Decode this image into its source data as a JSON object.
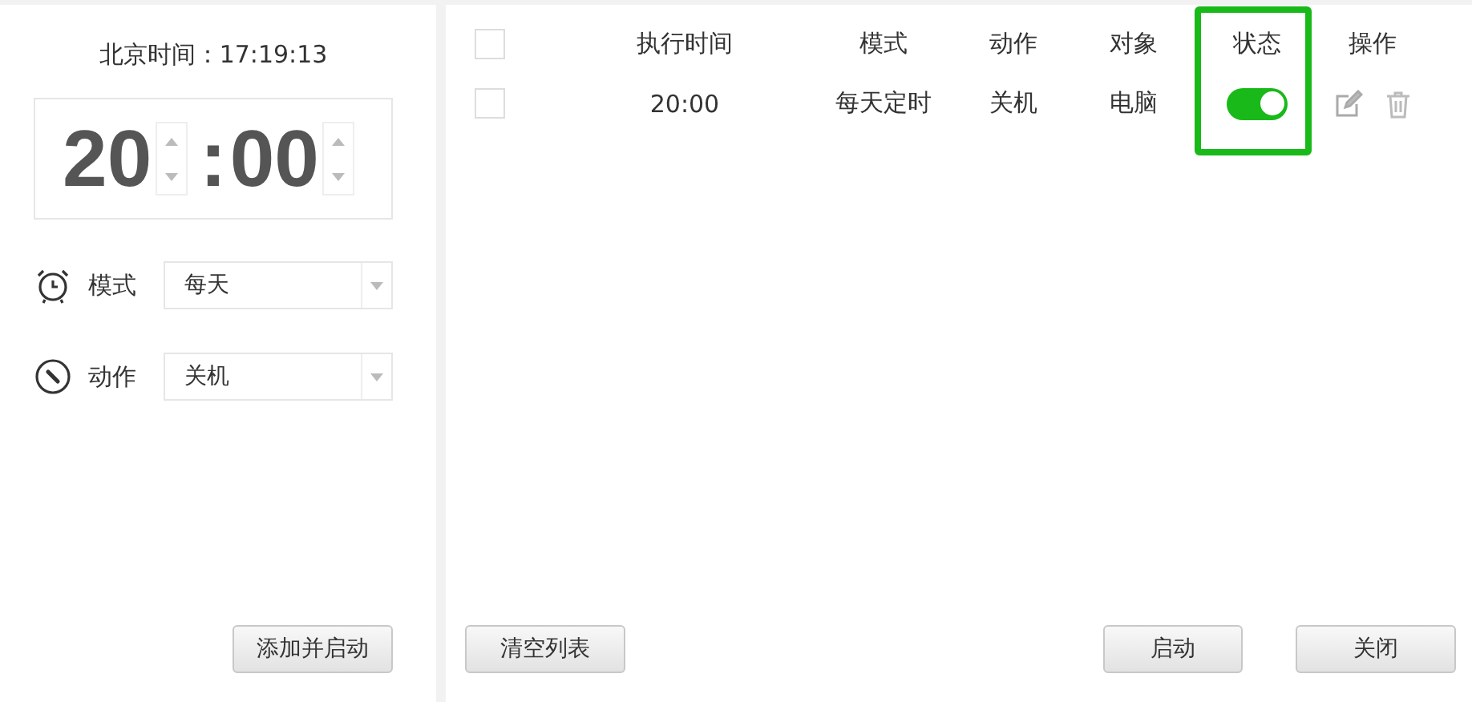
{
  "clock": {
    "label": "北京时间：17:19:13"
  },
  "time": {
    "hour": "20",
    "separator": ":",
    "minute": "00"
  },
  "fields": [
    {
      "kind": "mode",
      "label": "模式",
      "value": "每天"
    },
    {
      "kind": "action",
      "label": "动作",
      "value": "关机"
    }
  ],
  "add_button": "添加并启动",
  "table": {
    "header_checked": false,
    "columns": [
      {
        "label": "执行时间",
        "highlighted": false
      },
      {
        "label": "模式",
        "highlighted": false
      },
      {
        "label": "动作",
        "highlighted": false
      },
      {
        "label": "对象",
        "highlighted": false
      },
      {
        "label": "状态",
        "highlighted": true
      },
      {
        "label": "操作",
        "highlighted": false
      }
    ],
    "rows": [
      {
        "checked": false,
        "time": "20:00",
        "mode": "每天定时",
        "action": "关机",
        "target": "电脑",
        "on": true
      }
    ]
  },
  "buttons": {
    "clear": "清空列表",
    "start": "启动",
    "close": "关闭"
  }
}
